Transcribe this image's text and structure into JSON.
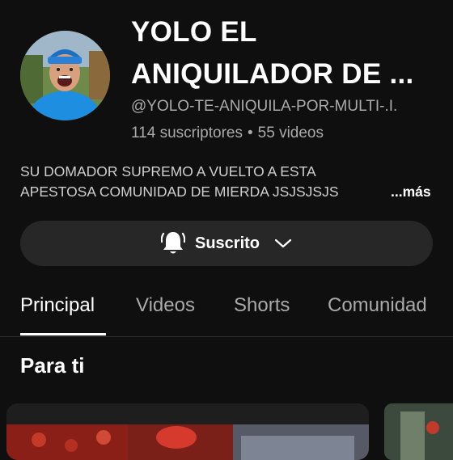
{
  "channel": {
    "name_line1": "YOLO EL",
    "name_line2": "ANIQUILADOR DE ...",
    "handle": "@YOLO-TE-ANIQUILA-POR-MULTI-.I.",
    "subscribers": "114 suscriptores",
    "separator": "•",
    "videos": "55 videos",
    "description_line1": "SU DOMADOR SUPREMO A VUELTO A ESTA",
    "description_line2": "APESTOSA COMUNIDAD DE MIERDA JSJSJSJS",
    "more_label": "...más"
  },
  "subscribe": {
    "label": "Suscrito",
    "icon": "bell-icon",
    "dropdown_icon": "chevron-down-icon"
  },
  "tabs": [
    {
      "label": "Principal",
      "active": true
    },
    {
      "label": "Videos",
      "active": false
    },
    {
      "label": "Shorts",
      "active": false
    },
    {
      "label": "Comunidad",
      "active": false
    }
  ],
  "section": {
    "title": "Para ti"
  },
  "colors": {
    "background": "#0f0f0f",
    "button_bg": "#272727",
    "secondary_text": "#aaaaaa",
    "avatar_shirt": "#1e8fe0"
  }
}
